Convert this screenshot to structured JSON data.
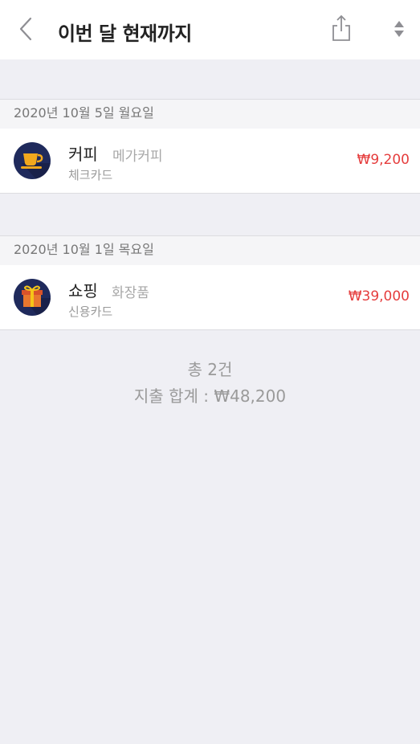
{
  "header": {
    "title": "이번 달 현재까지",
    "icons": {
      "back": "chevron-left-icon",
      "share": "share-icon",
      "sort": "sort-icon"
    }
  },
  "groups": [
    {
      "date": "2020년 10월 5일 월요일",
      "transactions": [
        {
          "category": "커피",
          "merchant": "메가커피",
          "method": "체크카드",
          "amount": "₩9,200",
          "icon": "coffee-cup-icon"
        }
      ]
    },
    {
      "date": "2020년 10월 1일 목요일",
      "transactions": [
        {
          "category": "쇼핑",
          "merchant": "화장품",
          "method": "신용카드",
          "amount": "₩39,000",
          "icon": "gift-icon"
        }
      ]
    }
  ],
  "summary": {
    "count": "총 2건",
    "total": "지출 합계 : ₩48,200"
  },
  "colors": {
    "background": "#efeff4",
    "amount": "#e53d3d",
    "icon_circle": "#1f2a5c"
  }
}
